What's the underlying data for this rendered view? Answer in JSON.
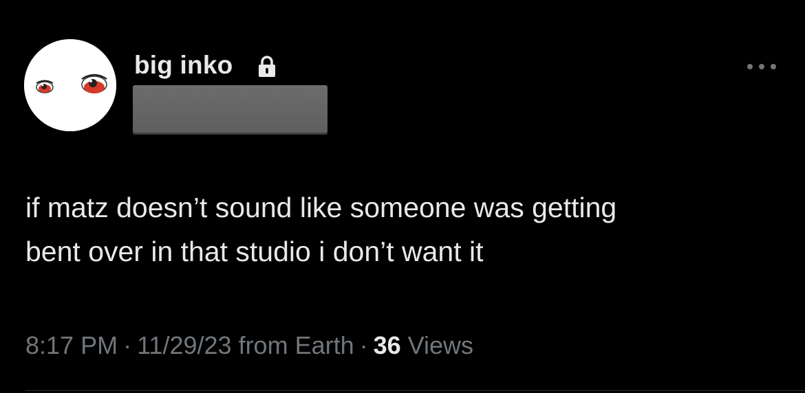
{
  "colors": {
    "background": "#000000",
    "primary_text": "#e7e9ea",
    "secondary_text": "#71767b",
    "divider": "#2f3336",
    "redaction": "#666666"
  },
  "author": {
    "display_name": "big inko",
    "protected_icon": "lock-icon",
    "avatar_icon": "avatar-red-eyes"
  },
  "header": {
    "more_icon": "more-dots-icon"
  },
  "tweet": {
    "text": "if matz doesn’t sound like someone was getting\nbent over in that studio i don’t want it"
  },
  "meta": {
    "time": "8:17 PM",
    "sep1": "·",
    "date": "11/29/23",
    "source": "from Earth",
    "sep2": "·",
    "views_count": "36",
    "views_label": "Views"
  }
}
